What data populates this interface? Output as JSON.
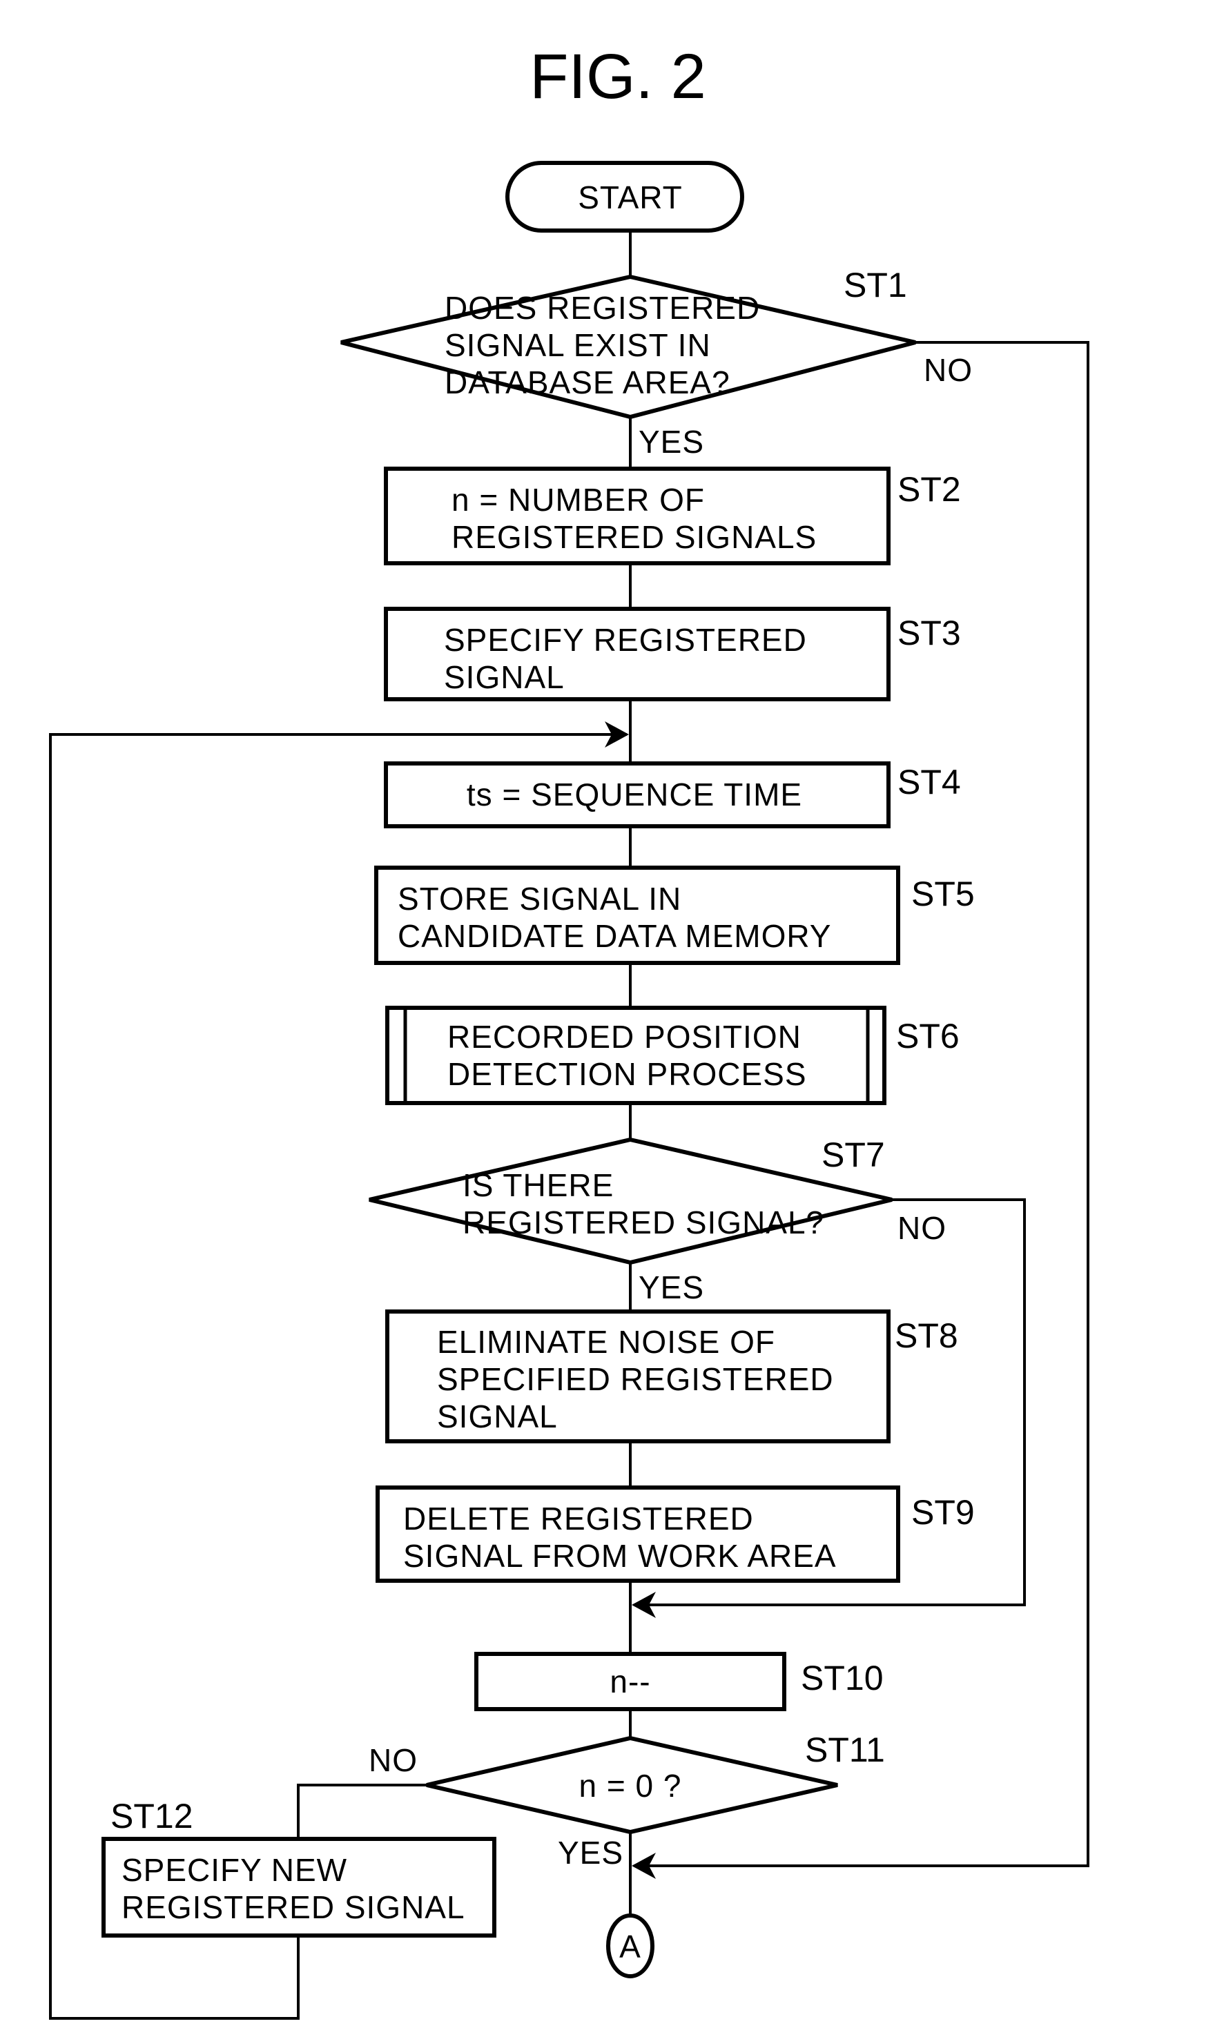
{
  "figure": {
    "title": "FIG. 2",
    "start_label": "START",
    "connector_label": "A"
  },
  "steps": {
    "st1": {
      "id": "ST1",
      "type": "decision",
      "lines": [
        "DOES REGISTERED",
        "SIGNAL EXIST IN",
        "DATABASE AREA?"
      ],
      "yes": "YES",
      "no": "NO"
    },
    "st2": {
      "id": "ST2",
      "type": "process",
      "lines": [
        "n = NUMBER OF",
        "REGISTERED SIGNALS"
      ]
    },
    "st3": {
      "id": "ST3",
      "type": "process",
      "lines": [
        "SPECIFY REGISTERED",
        "SIGNAL"
      ]
    },
    "st4": {
      "id": "ST4",
      "type": "process",
      "lines": [
        "ts = SEQUENCE TIME"
      ]
    },
    "st5": {
      "id": "ST5",
      "type": "process",
      "lines": [
        "STORE SIGNAL IN",
        "CANDIDATE DATA MEMORY"
      ]
    },
    "st6": {
      "id": "ST6",
      "type": "predefined-process",
      "lines": [
        "RECORDED POSITION",
        "DETECTION PROCESS"
      ]
    },
    "st7": {
      "id": "ST7",
      "type": "decision",
      "lines": [
        "IS THERE",
        "REGISTERED SIGNAL?"
      ],
      "yes": "YES",
      "no": "NO"
    },
    "st8": {
      "id": "ST8",
      "type": "process",
      "lines": [
        "ELIMINATE NOISE OF",
        "SPECIFIED REGISTERED",
        "SIGNAL"
      ]
    },
    "st9": {
      "id": "ST9",
      "type": "process",
      "lines": [
        "DELETE REGISTERED",
        "SIGNAL FROM WORK AREA"
      ]
    },
    "st10": {
      "id": "ST10",
      "type": "process",
      "lines": [
        "n--"
      ]
    },
    "st11": {
      "id": "ST11",
      "type": "decision",
      "lines": [
        "n = 0 ?"
      ],
      "yes": "YES",
      "no": "NO"
    },
    "st12": {
      "id": "ST12",
      "type": "process",
      "lines": [
        "SPECIFY NEW",
        "REGISTERED SIGNAL"
      ]
    }
  }
}
